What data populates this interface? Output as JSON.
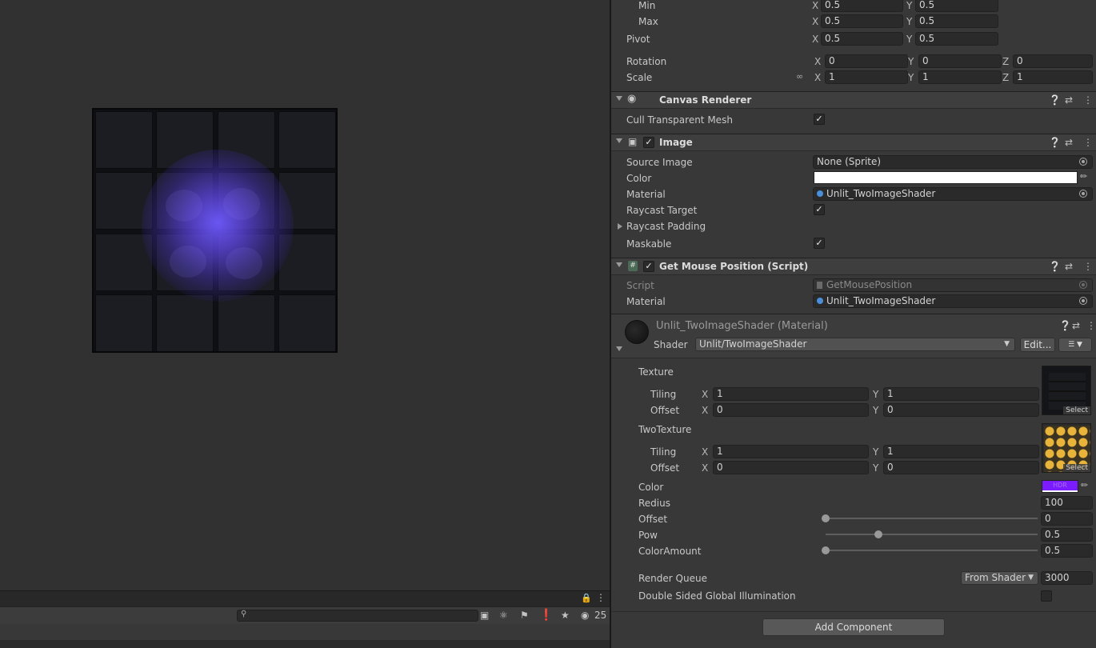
{
  "rect_transform": {
    "min": {
      "label": "Min",
      "x": "0.5",
      "y": "0.5"
    },
    "max": {
      "label": "Max",
      "x": "0.5",
      "y": "0.5"
    },
    "pivot": {
      "label": "Pivot",
      "x": "0.5",
      "y": "0.5"
    },
    "rotation": {
      "label": "Rotation",
      "x": "0",
      "y": "0",
      "z": "0"
    },
    "scale": {
      "label": "Scale",
      "x": "1",
      "y": "1",
      "z": "1"
    }
  },
  "axes": {
    "x": "X",
    "y": "Y",
    "z": "Z"
  },
  "canvas_renderer": {
    "title": "Canvas Renderer",
    "cull_label": "Cull Transparent Mesh",
    "cull_checked": true
  },
  "image": {
    "title": "Image",
    "source_image_label": "Source Image",
    "source_image_value": "None (Sprite)",
    "color_label": "Color",
    "color_value": "#ffffff",
    "material_label": "Material",
    "material_value": "Unlit_TwoImageShader",
    "raycast_target_label": "Raycast Target",
    "raycast_padding_label": "Raycast Padding",
    "maskable_label": "Maskable"
  },
  "get_mouse_position": {
    "title": "Get Mouse Position (Script)",
    "script_label": "Script",
    "script_value": "GetMousePosition",
    "material_label": "Material",
    "material_value": "Unlit_TwoImageShader"
  },
  "material": {
    "title": "Unlit_TwoImageShader (Material)",
    "shader_label": "Shader",
    "shader_value": "Unlit/TwoImageShader",
    "edit_button": "Edit...",
    "texture_label": "Texture",
    "texture_tiling_label": "Tiling",
    "texture_tiling": {
      "x": "1",
      "y": "1"
    },
    "texture_offset_label": "Offset",
    "texture_offset": {
      "x": "0",
      "y": "0"
    },
    "two_texture_label": "TwoTexture",
    "two_tiling_label": "Tiling",
    "two_tiling": {
      "x": "1",
      "y": "1"
    },
    "two_offset_label": "Offset",
    "two_offset": {
      "x": "0",
      "y": "0"
    },
    "select_label": "Select",
    "color_label": "Color",
    "color_value": "#7a1cff",
    "hdr_label": "HDR",
    "redius_label": "Redius",
    "redius_value": "100",
    "offset_label": "Offset",
    "offset_value": "0",
    "offset_fraction": 0.0,
    "pow_label": "Pow",
    "pow_value": "0.5",
    "pow_fraction": 0.25,
    "color_amount_label": "ColorAmount",
    "color_amount_value": "0.5",
    "color_amount_fraction": 0.0,
    "render_queue_label": "Render Queue",
    "render_queue_mode": "From Shader",
    "render_queue_value": "3000",
    "double_sided_label": "Double Sided Global Illumination",
    "double_sided_checked": false
  },
  "add_component": "Add Component",
  "console": {
    "hidden_count": "25",
    "search_placeholder": ""
  }
}
